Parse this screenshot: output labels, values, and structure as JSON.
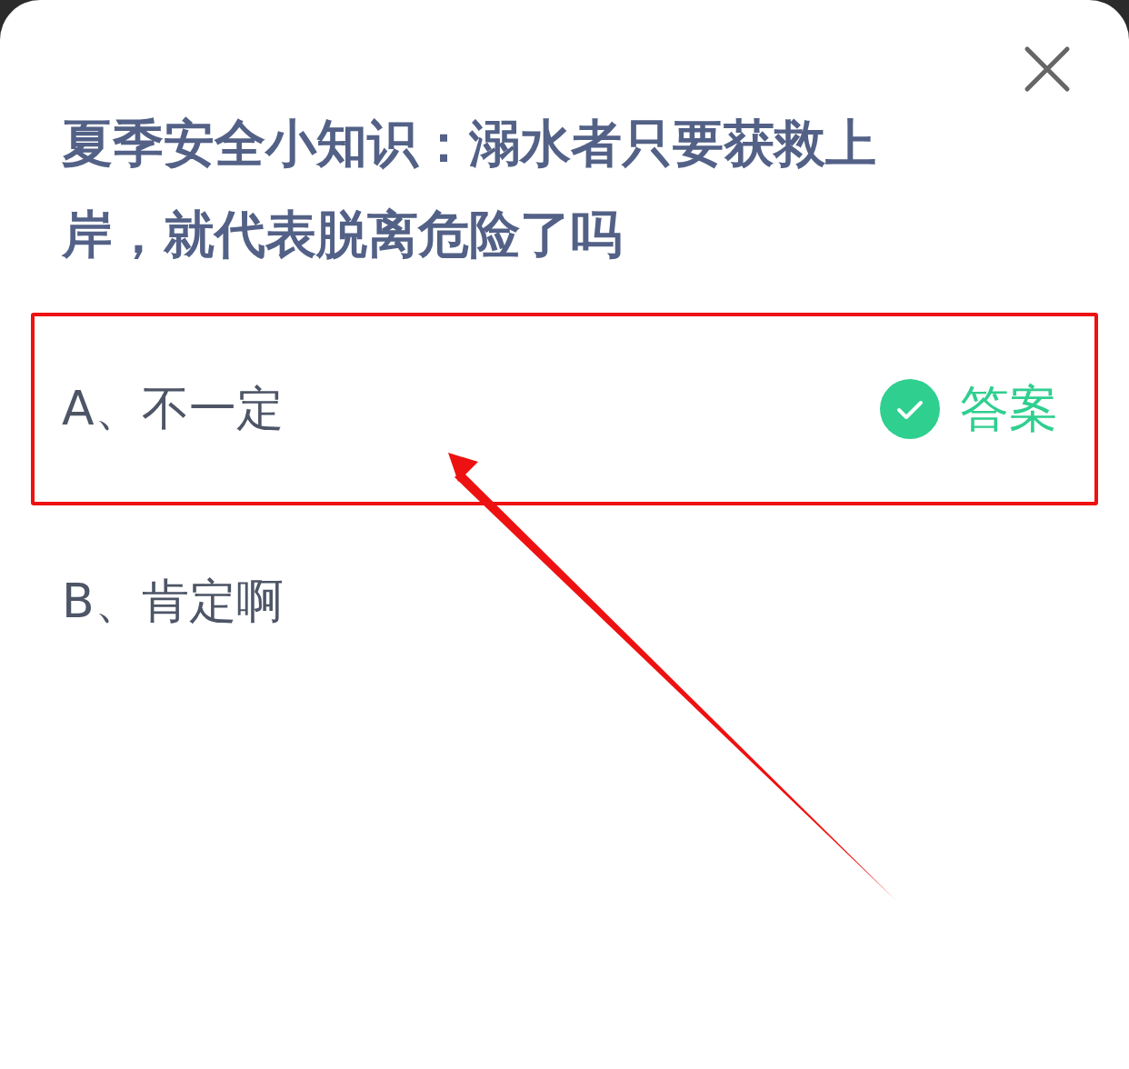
{
  "question": {
    "title": "夏季安全小知识：溺水者只要获救上岸，就代表脱离危险了吗"
  },
  "options": [
    {
      "label": "A、不一定",
      "correct": true,
      "answer_label": "答案",
      "highlighted": true
    },
    {
      "label": "B、肯定啊",
      "correct": false,
      "highlighted": false
    }
  ]
}
